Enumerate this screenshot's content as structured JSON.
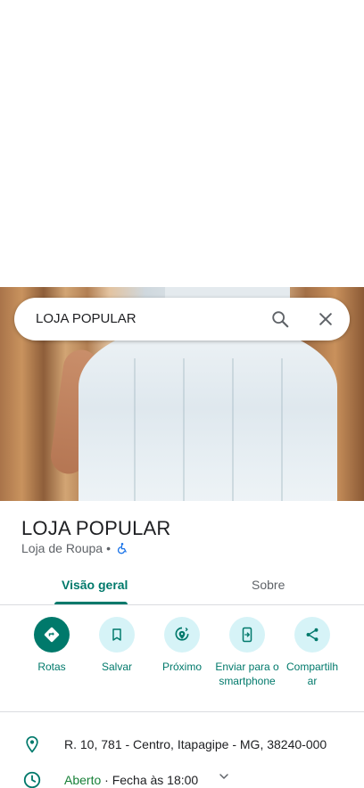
{
  "search": {
    "query": "LOJA POPULAR"
  },
  "place": {
    "name": "LOJA POPULAR",
    "category": "Loja de Roupa",
    "separator": "•"
  },
  "tabs": [
    {
      "label": "Visão geral",
      "active": true
    },
    {
      "label": "Sobre",
      "active": false
    }
  ],
  "actions": [
    {
      "label": "Rotas",
      "icon": "directions-icon"
    },
    {
      "label": "Salvar",
      "icon": "bookmark-icon"
    },
    {
      "label": "Próximo",
      "icon": "nearby-icon"
    },
    {
      "label": "Enviar para o smartphone",
      "icon": "send-to-phone-icon"
    },
    {
      "label": "Compartilhar",
      "icon": "share-icon"
    }
  ],
  "info": {
    "address": "R. 10, 781 - Centro, Itapagipe - MG, 38240-000",
    "hours_status": "Aberto",
    "hours_detail": " · Fecha às 18:00"
  },
  "colors": {
    "accent": "#00796b",
    "action_bg": "#d6f3f7",
    "open": "#188038",
    "accessibility": "#1a73e8"
  }
}
